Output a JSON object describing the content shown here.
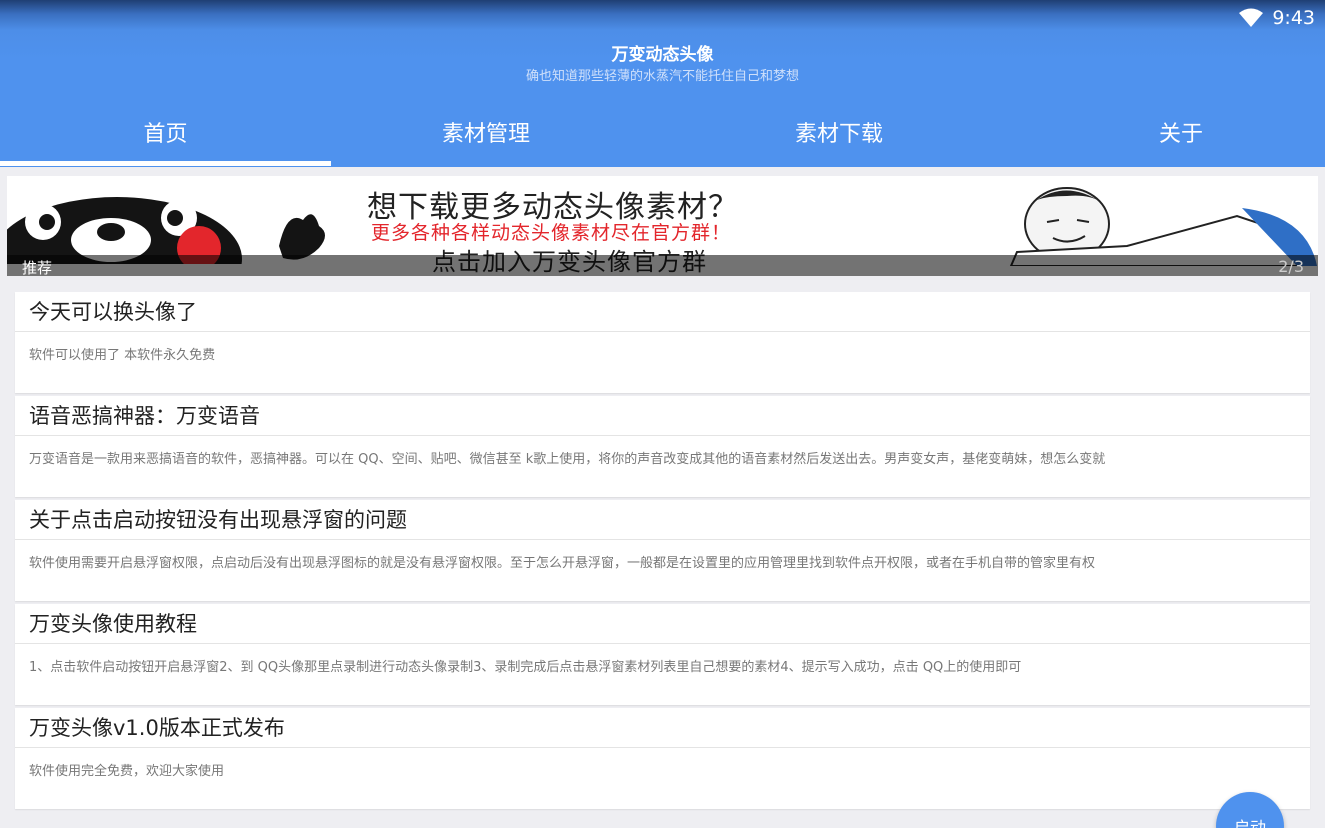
{
  "statusbar": {
    "time": "9:43",
    "wifi_icon": "wifi-icon"
  },
  "header": {
    "title": "万变动态头像",
    "subtitle": "确也知道那些轻薄的水蒸汽不能托住自己和梦想"
  },
  "tabs": [
    {
      "label": "首页",
      "active": true
    },
    {
      "label": "素材管理",
      "active": false
    },
    {
      "label": "素材下载",
      "active": false
    },
    {
      "label": "关于",
      "active": false
    }
  ],
  "banner": {
    "line1": "想下载更多动态头像素材？",
    "line2": "更多各种各样动态头像素材尽在官方群！",
    "line3": "点击加入万变头像官方群",
    "label": "推荐",
    "counter": "2/3"
  },
  "articles": [
    {
      "title": "今天可以换头像了",
      "body": "软件可以使用了 本软件永久免费"
    },
    {
      "title": "语音恶搞神器：万变语音",
      "body": "万变语音是一款用来恶搞语音的软件，恶搞神器。可以在 QQ、空间、贴吧、微信甚至 k歌上使用，将你的声音改变成其他的语音素材然后发送出去。男声变女声，基佬变萌妹，想怎么变就"
    },
    {
      "title": "关于点击启动按钮没有出现悬浮窗的问题",
      "body": "软件使用需要开启悬浮窗权限，点启动后没有出现悬浮图标的就是没有悬浮窗权限。至于怎么开悬浮窗，一般都是在设置里的应用管理里找到软件点开权限，或者在手机自带的管家里有权"
    },
    {
      "title": "万变头像使用教程",
      "body": "1、点击软件启动按钮开启悬浮窗2、到 QQ头像那里点录制进行动态头像录制3、录制完成后点击悬浮窗素材列表里自己想要的素材4、提示写入成功，点击 QQ上的使用即可"
    },
    {
      "title": "万变头像v1.0版本正式发布",
      "body": "软件使用完全免费，欢迎大家使用"
    }
  ],
  "fab": {
    "label": "启动"
  },
  "colors": {
    "primary": "#4f92ee",
    "banner_red": "#e3262c"
  }
}
